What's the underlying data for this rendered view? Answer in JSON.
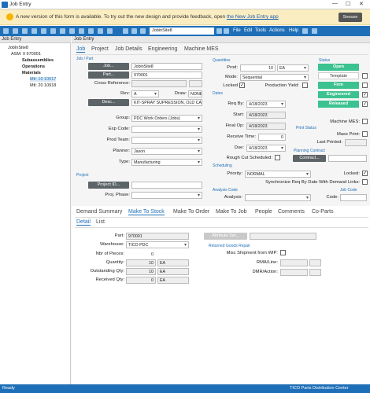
{
  "window": {
    "title": "Job Entry",
    "min": "—",
    "max": "☐",
    "close": "✕"
  },
  "banner": {
    "message": "A new version of this form is available. To try out the new design and provide feedback, open ",
    "link": "the New Job Entry app",
    "snooze": "Snooze"
  },
  "toolbar": {
    "job_value": "JobinSite8",
    "menus": [
      "File",
      "Edit",
      "Tools",
      "Actions",
      "Help"
    ]
  },
  "tree": {
    "header": "Job Entry",
    "items": [
      "JobInSite8",
      "ASM: 0 970001",
      "Subassemblies",
      "Operations",
      "Materials",
      "Mtl: 10 10017",
      "Mtl: 20 10918"
    ]
  },
  "main": {
    "header": "Job Entry"
  },
  "tabs": [
    "Job",
    "Project",
    "Job Details",
    "Engineering",
    "Machine MES"
  ],
  "job_part": {
    "section": "Job / Part",
    "job_btn": "Job...",
    "job": "JobinSite8",
    "part_btn": "Part...",
    "part": "970001",
    "crossref_label": "Cross Reference:",
    "crossref": "",
    "rev_label": "Rev:",
    "rev": "A",
    "draw_label": "Draw:",
    "draw": "NONE",
    "desc_btn": "Desc...",
    "desc": "KIT-SPRAY SUPRESSION, OLD CAB"
  },
  "group": {
    "group_label": "Group:",
    "group": "PDC Work Orders (Jobs)",
    "exp_label": "Exp Code:",
    "exp": "",
    "prodteam_label": "Prod Team:",
    "prodteam": "",
    "planner_label": "Planner:",
    "planner": "Jason",
    "type_label": "Type:",
    "type": "Manufacturing"
  },
  "project": {
    "section": "Project",
    "btn": "Project ID...",
    "id": "",
    "phase_label": "Proj. Phase:",
    "phase": ""
  },
  "quantities": {
    "section": "Quantities",
    "prod_label": "Prod:",
    "prod": "10",
    "uom": "EA",
    "mode_label": "Mode:",
    "mode": "Sequential",
    "locked_label": "Locked",
    "prodyield_label": "Production Yield:"
  },
  "dates": {
    "section": "Dates",
    "reqby_label": "Req By:",
    "reqby": "4/18/2023",
    "start_label": "Start:",
    "start": "4/18/2023",
    "finalop_label": "Final Op:",
    "finalop": "4/18/2023",
    "receive_label": "Receive Time:",
    "receive": "0",
    "due_label": "Due:",
    "due": "4/18/2023",
    "roughcut_label": "Rough Cut Scheduled:"
  },
  "scheduling": {
    "section": "Scheduling",
    "priority_label": "Priority:",
    "priority": "NORMAL",
    "locked_label": "Locked:",
    "sync_label": "Synchronize Req By Date With Demand Links:"
  },
  "analysis": {
    "section": "Analysis Code",
    "label": "Analysis:",
    "value": ""
  },
  "status": {
    "section": "Status",
    "open": "Open",
    "template": "Template",
    "firm": "Firm",
    "engineered": "Engineered",
    "released": "Released",
    "machinemes_label": "Machine MES:",
    "massprint_label": "Mass Print:",
    "lastprinted_label": "Last Printed:",
    "printstatus_section": "Print Status",
    "planning_section": "Planning Contract",
    "contract_btn": "Contract...",
    "jobcode_section": "Job Code",
    "code_label": "Code:"
  },
  "tabs2": [
    "Demand Summary",
    "Make To Stock",
    "Make To Order",
    "Make To Job",
    "People",
    "Comments",
    "Co-Parts"
  ],
  "tabs3": [
    "Detail",
    "List"
  ],
  "detail": {
    "part_label": "Part:",
    "part": "970001",
    "attrset_btn": "Attribute Set...",
    "warehouse_label": "Warehouse:",
    "warehouse": "TICO PDC",
    "pieces_label": "Nbr of Pieces:",
    "pieces": "0",
    "qty_label": "Quantity:",
    "qty": "10",
    "qty_uom": "EA",
    "outstanding_label": "Outstanding Qty:",
    "outstanding": "10",
    "out_uom": "EA",
    "received_label": "Received Qty:",
    "received": "0",
    "rec_uom": "EA",
    "returned_section": "Returned Goods Repair",
    "misc_label": "Misc Shipment from WIP:",
    "rma_label": "RMA/Line:",
    "dmr_label": "DMR/Action:"
  },
  "statusbar": {
    "left": "Ready",
    "right": "TICO Parts Distribution Center"
  }
}
